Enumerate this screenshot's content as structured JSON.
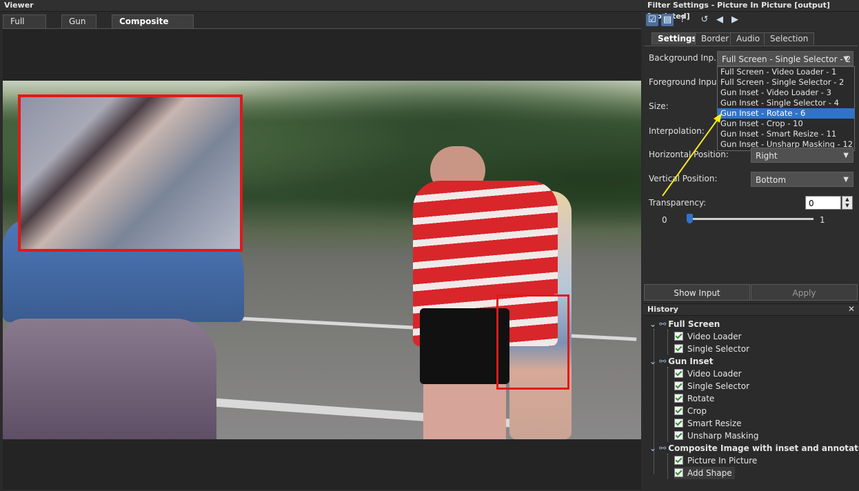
{
  "viewer": {
    "title": "Viewer",
    "tabs": [
      {
        "label": "Full Screen"
      },
      {
        "label": "Gun Inset"
      },
      {
        "label": "Composite Image with inset and annotations"
      }
    ],
    "close_glyph": "✕"
  },
  "filter_settings": {
    "title": "Filter Settings - Picture In Picture [output] [updated]",
    "toolbar_icons": [
      "checkbox-icon",
      "clipboard-icon",
      "help-icon",
      "undo-icon",
      "back-icon",
      "forward-icon"
    ],
    "tabs": [
      {
        "label": "Settings"
      },
      {
        "label": "Border"
      },
      {
        "label": "Audio"
      },
      {
        "label": "Selection"
      }
    ],
    "fields": {
      "background_input": {
        "label": "Background Inp...",
        "value": "Full Screen - Single Selector - 2"
      },
      "foreground_input": {
        "label": "Foreground Input:"
      },
      "size": {
        "label": "Size:"
      },
      "interpolation": {
        "label": "Interpolation:"
      },
      "horizontal_position": {
        "label": "Horizontal Position:",
        "value": "Right"
      },
      "vertical_position": {
        "label": "Vertical Position:",
        "value": "Bottom"
      },
      "transparency": {
        "label": "Transparency:",
        "value": "0",
        "min_label": "0",
        "max_label": "1",
        "level": 0
      }
    },
    "dropdown_options": [
      "Full Screen - Video Loader - 1",
      "Full Screen - Single Selector - 2",
      "Gun Inset - Video Loader - 3",
      "Gun Inset - Single Selector - 4",
      "Gun Inset - Rotate - 6",
      "Gun Inset - Crop - 10",
      "Gun Inset - Smart Resize - 11",
      "Gun Inset - Unsharp Masking - 12"
    ],
    "dropdown_selected_index": 4,
    "buttons": {
      "show_input": "Show Input",
      "apply": "Apply"
    },
    "annotation_color": "#f5ec1a"
  },
  "history": {
    "title": "History",
    "close_glyph": "✕",
    "groups": [
      {
        "label": "Full Screen",
        "items": [
          "Video Loader",
          "Single Selector"
        ]
      },
      {
        "label": "Gun Inset",
        "items": [
          "Video Loader",
          "Single Selector",
          "Rotate",
          "Crop",
          "Smart Resize",
          "Unsharp Masking"
        ]
      },
      {
        "label": "Composite Image with inset and annotations",
        "items": [
          "Picture In Picture",
          "Add Shape"
        ]
      }
    ]
  },
  "colors": {
    "accent": "#2f74c9",
    "annotation_red": "#e31818"
  }
}
